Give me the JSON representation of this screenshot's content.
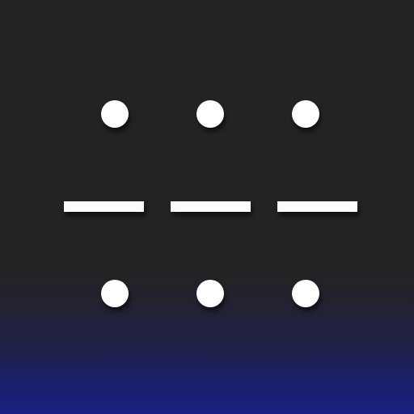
{
  "icon": {
    "name": "dots-and-dashes-icon",
    "colors": {
      "background_top": "#232323",
      "background_bottom": "#172080",
      "mark": "#ffffff"
    },
    "rows": [
      {
        "kind": "dots",
        "count": 3
      },
      {
        "kind": "dashes",
        "count": 3
      },
      {
        "kind": "dots",
        "count": 3
      }
    ]
  }
}
